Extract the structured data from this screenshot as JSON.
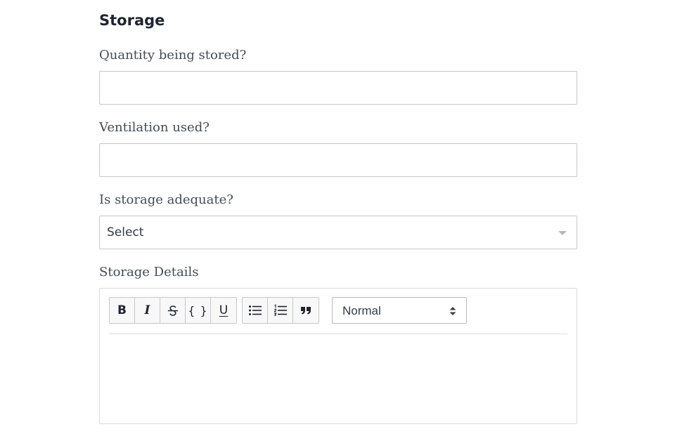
{
  "section": {
    "title": "Storage"
  },
  "fields": {
    "quantity": {
      "label": "Quantity being stored?",
      "value": "",
      "placeholder": ""
    },
    "ventilation": {
      "label": "Ventilation used?",
      "value": "",
      "placeholder": ""
    },
    "adequate": {
      "label": "Is storage adequate?",
      "selected": "Select"
    },
    "details": {
      "label": "Storage Details",
      "content": ""
    }
  },
  "toolbar": {
    "bold": "B",
    "italic": "I",
    "code": "{ }",
    "underline": "U",
    "heading_value": "Normal"
  },
  "icons": {
    "bold": "bold-icon",
    "italic": "italic-icon",
    "strike": "strikethrough-icon",
    "code": "code-icon",
    "underline": "underline-icon",
    "bullet_list": "bullet-list-icon",
    "ordered_list": "ordered-list-icon",
    "quote": "blockquote-icon",
    "select_caret": "caret-down-icon",
    "heading_arrows": "up-down-arrows-icon"
  },
  "colors": {
    "border": "#c4c7cc",
    "text": "#2f3440",
    "caret": "#b5b8bd"
  }
}
